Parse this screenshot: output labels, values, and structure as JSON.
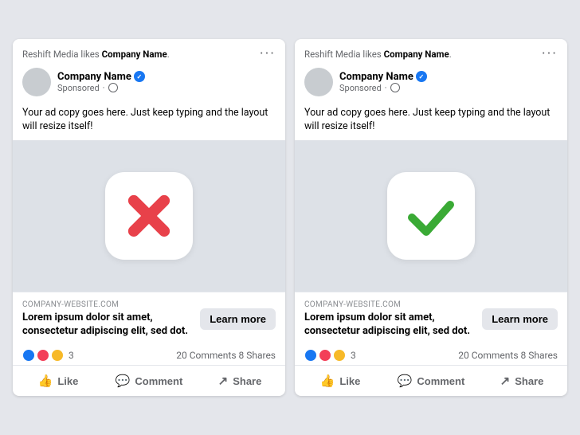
{
  "cards": [
    {
      "id": "card-bad",
      "likes_text_prefix": "Reshift Media likes ",
      "company_name": "Company Name",
      "likes_text_suffix": ".",
      "page_name": "Company Name",
      "sponsored_label": "Sponsored",
      "ad_copy": "Your ad copy goes here. Just keep typing and the layout will resize itself!",
      "website": "COMPANY-WEBSITE.COM",
      "headline": "Lorem ipsum dolor sit amet, consectetur adipiscing elit, sed dot.",
      "learn_more": "Learn more",
      "reaction_count": "3",
      "comments_shares": "20 Comments  8 Shares",
      "action_like": "Like",
      "action_comment": "Comment",
      "action_share": "Share",
      "icon_type": "x",
      "dots": "···"
    },
    {
      "id": "card-good",
      "likes_text_prefix": "Reshift Media likes ",
      "company_name": "Company Name",
      "likes_text_suffix": ".",
      "page_name": "Company Name",
      "sponsored_label": "Sponsored",
      "ad_copy": "Your ad copy goes here. Just keep typing and the layout will resize itself!",
      "website": "COMPANY-WEBSITE.COM",
      "headline": "Lorem ipsum dolor sit amet, consectetur adipiscing elit, sed dot.",
      "learn_more": "Learn more",
      "reaction_count": "3",
      "comments_shares": "20 Comments  8 Shares",
      "action_like": "Like",
      "action_comment": "Comment",
      "action_share": "Share",
      "icon_type": "check",
      "dots": "···"
    }
  ],
  "colors": {
    "x_color": "#e8414a",
    "check_color": "#3aaa35",
    "facebook_blue": "#1877f2"
  }
}
